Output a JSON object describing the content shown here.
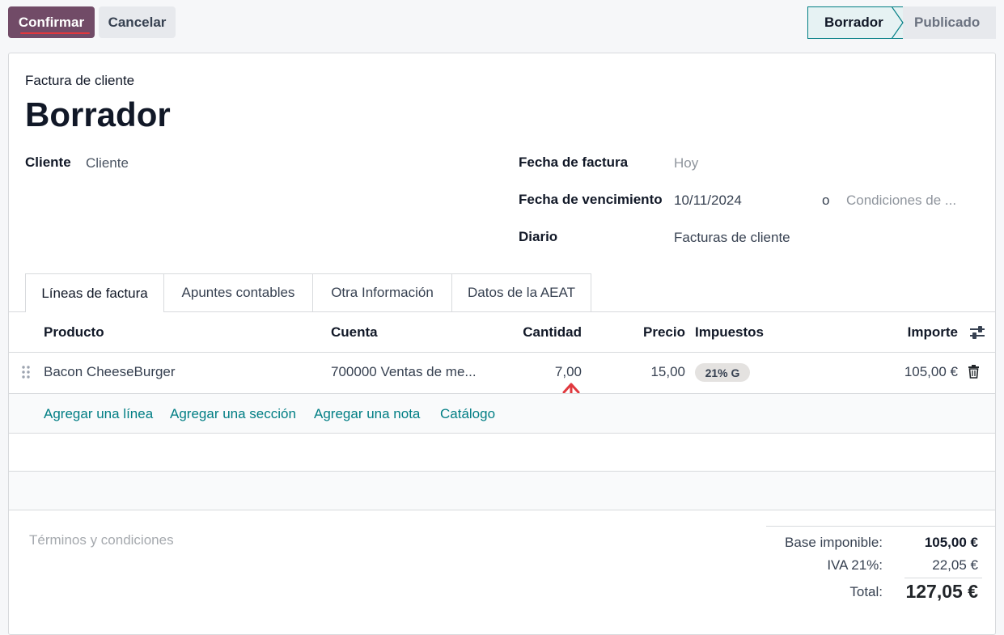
{
  "toolbar": {
    "confirm_label": "Confirmar",
    "cancel_label": "Cancelar"
  },
  "statusbar": {
    "stages": [
      "Borrador",
      "Publicado"
    ],
    "active": "Borrador"
  },
  "header": {
    "doc_type": "Factura de cliente",
    "title": "Borrador"
  },
  "fields": {
    "cliente_label": "Cliente",
    "cliente_placeholder": "Cliente",
    "fecha_factura_label": "Fecha de factura",
    "fecha_factura_placeholder": "Hoy",
    "fecha_vencimiento_label": "Fecha de vencimiento",
    "fecha_vencimiento_value": "10/11/2024",
    "or_text": "o",
    "condiciones_placeholder": "Condiciones de ...",
    "diario_label": "Diario",
    "diario_value": "Facturas de cliente"
  },
  "tabs": [
    {
      "label": "Líneas de factura",
      "active": true
    },
    {
      "label": "Apuntes contables",
      "active": false
    },
    {
      "label": "Otra Información",
      "active": false
    },
    {
      "label": "Datos de la AEAT",
      "active": false
    }
  ],
  "table": {
    "headers": [
      "Producto",
      "Cuenta",
      "Cantidad",
      "Precio",
      "Impuestos",
      "Importe"
    ],
    "rows": [
      {
        "producto": "Bacon CheeseBurger",
        "cuenta": "700000 Ventas de me...",
        "cantidad": "7,00",
        "precio": "15,00",
        "impuestos": "21% G",
        "importe": "105,00 €"
      }
    ],
    "add_links": [
      "Agregar una línea",
      "Agregar una sección",
      "Agregar una nota",
      "Catálogo"
    ]
  },
  "footer": {
    "terms_placeholder": "Términos y condiciones",
    "base_label": "Base imponible:",
    "base_value": "105,00 €",
    "iva_label": "IVA 21%:",
    "iva_value": "22,05 €",
    "total_label": "Total:",
    "total_value": "127,05 €"
  },
  "colors": {
    "brand": "#714b67",
    "accent": "#017e84",
    "annotation": "#e0383e"
  },
  "icons": [
    "drag-handle-icon",
    "trash-icon",
    "column-settings-icon",
    "annotation-arrow-icon"
  ]
}
